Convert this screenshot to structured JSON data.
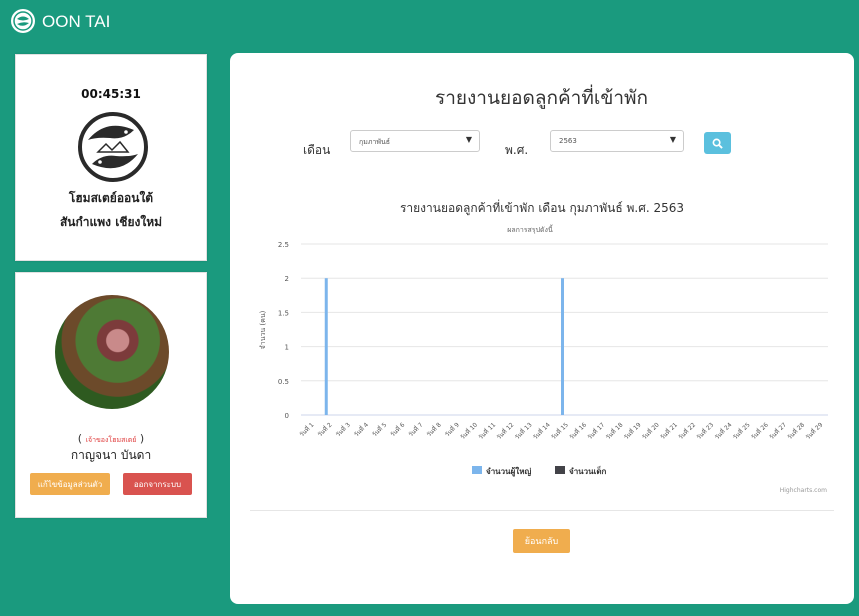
{
  "app": {
    "brand": "OON TAI"
  },
  "clock_card": {
    "time": "00:45:31",
    "home_name_line1": "โฮมสเตย์ออนใต้",
    "home_name_line2": "สันกำแพง เชียงใหม่"
  },
  "user_card": {
    "role_open": "( ",
    "role": "เจ้าของโฮมสเตย์",
    "role_close": " )",
    "name": "กาญจนา บันดา",
    "edit_label": "แก้ไขข้อมูลส่วนตัว",
    "logout_label": "ออกจากระบบ"
  },
  "report": {
    "title": "รายงานยอดลูกค้าที่เข้าพัก",
    "month_label": "เดือน",
    "month_value": "กุมภาพันธ์",
    "year_label": "พ.ศ.",
    "year_value": "2563",
    "back_label": "ย้อนกลับ"
  },
  "colors": {
    "accent": "#1a9a7e",
    "adult": "#7cb5ec",
    "child": "#434348",
    "search": "#5bc0de",
    "warning": "#f0ad4e",
    "danger": "#d9534f"
  },
  "chart_data": {
    "type": "bar",
    "title": "รายงานยอดลูกค้าที่เข้าพัก เดือน กุมภาพันธ์ พ.ศ. 2563",
    "subtitle": "ผลการสรุปดังนี้",
    "ylabel": "จำนวน (คน)",
    "xlabel": "",
    "ylim": [
      0,
      2.5
    ],
    "yticks": [
      "0",
      "0.5",
      "1",
      "1.5",
      "2",
      "2.5"
    ],
    "categories": [
      "วันที่ 1",
      "วันที่ 2",
      "วันที่ 3",
      "วันที่ 4",
      "วันที่ 5",
      "วันที่ 6",
      "วันที่ 7",
      "วันที่ 8",
      "วันที่ 9",
      "วันที่ 10",
      "วันที่ 11",
      "วันที่ 12",
      "วันที่ 13",
      "วันที่ 14",
      "วันที่ 15",
      "วันที่ 16",
      "วันที่ 17",
      "วันที่ 18",
      "วันที่ 19",
      "วันที่ 20",
      "วันที่ 21",
      "วันที่ 22",
      "วันที่ 23",
      "วันที่ 24",
      "วันที่ 25",
      "วันที่ 26",
      "วันที่ 27",
      "วันที่ 28",
      "วันที่ 29"
    ],
    "series": [
      {
        "name": "จำนวนผู้ใหญ่",
        "color": "#7cb5ec",
        "values": [
          0,
          2,
          0,
          0,
          0,
          0,
          0,
          0,
          0,
          0,
          0,
          0,
          0,
          0,
          2,
          0,
          0,
          0,
          0,
          0,
          0,
          0,
          0,
          0,
          0,
          0,
          0,
          0,
          0
        ]
      },
      {
        "name": "จำนวนเด็ก",
        "color": "#434348",
        "values": [
          0,
          0,
          0,
          0,
          0,
          0,
          0,
          0,
          0,
          0,
          0,
          0,
          0,
          0,
          0,
          0,
          0,
          0,
          0,
          0,
          0,
          0,
          0,
          0,
          0,
          0,
          0,
          0,
          0
        ]
      }
    ],
    "grid": true,
    "legend": "bottom-center",
    "credits": "Highcharts.com"
  }
}
